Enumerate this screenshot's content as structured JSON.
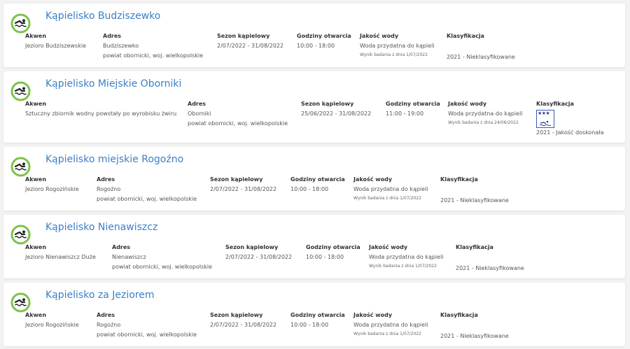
{
  "labels": {
    "akwen": "Akwen",
    "adres": "Adres",
    "sezon": "Sezon kąpielowy",
    "godziny": "Godziny otwarcia",
    "jakosc": "Jakość wody",
    "klasyfikacja": "Klasyfikacja"
  },
  "icon": "swimming-icon",
  "colors": {
    "title": "#3a7fc8",
    "icon_ring": "#7cc34a"
  },
  "beaches": [
    {
      "title": "Kąpielisko Budziszewko",
      "akwen": "Jezioro Budziszewskie",
      "adres1": "Budziszewko",
      "adres2": "powiat obornicki, woj. wielkopolskie",
      "sezon": "2/07/2022 - 31/08/2022",
      "godziny": "10:00 - 18:00",
      "jakosc": "Woda przydatna do kąpieli",
      "badanie": "Wynik badania z dnia 1/07/2022",
      "klasyfikacja": "2021 - Nieklasyfikowane"
    },
    {
      "title": "Kąpielisko Miejskie Oborniki",
      "akwen": "Sztuczny zbiornik wodny powstały po wyrobisku żwiru",
      "adres1": "Oborniki",
      "adres2": "powiat obornicki, woj. wielkopolskie",
      "sezon": "25/06/2022 - 31/08/2022",
      "godziny": "11:00 - 19:00",
      "jakosc": "Woda przydatna do kąpieli",
      "badanie": "Wynik badania z dnia 24/06/2022",
      "klasyfikacja": "2021 - Jakość doskonała",
      "badge": "excellent-quality-badge"
    },
    {
      "title": "Kąpielisko miejskie Rogoźno",
      "akwen": "Jezioro Rogozińskie",
      "adres1": "Rogoźno",
      "adres2": "powiat obornicki, woj. wielkopolskie",
      "sezon": "2/07/2022 - 31/08/2022",
      "godziny": "10:00 - 18:00",
      "jakosc": "Woda przydatna do kąpieli",
      "badanie": "Wynik badania z dnia 1/07/2022",
      "klasyfikacja": "2021 - Nieklasyfikowane"
    },
    {
      "title": "Kąpielisko Nienawiszcz",
      "akwen": "Jezioro Nienawiszcz Duże",
      "adres1": "Nienawiszcz",
      "adres2": "powiat obornicki, woj. wielkopolskie",
      "sezon": "2/07/2022 - 31/08/2022",
      "godziny": "10:00 - 18:00",
      "jakosc": "Woda przydatna do kąpieli",
      "badanie": "Wynik badania z dnia 1/07/2022",
      "klasyfikacja": "2021 - Nieklasyfikowane"
    },
    {
      "title": "Kąpielisko za Jeziorem",
      "akwen": "Jezioro Rogozińskie",
      "adres1": "Rogoźno",
      "adres2": "powiat obornicki, woj. wielkopolskie",
      "sezon": "2/07/2022 - 31/08/2022",
      "godziny": "10:00 - 18:00",
      "jakosc": "Woda przydatna do kąpieli",
      "badanie": "Wynik badania z dnia 1/07/2022",
      "klasyfikacja": "2021 - Nieklasyfikowane"
    }
  ]
}
